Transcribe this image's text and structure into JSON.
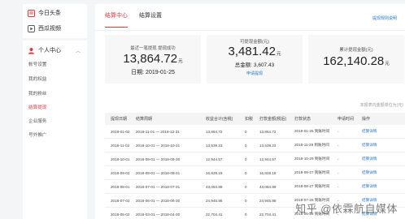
{
  "sidebar": {
    "top_items": [
      {
        "label": "今日头条",
        "icon": "toutiao-icon"
      },
      {
        "label": "西瓜视频",
        "icon": "xigua-icon"
      }
    ],
    "section_label": "个人中心",
    "sub_items": [
      "帐号设置",
      "我的权益",
      "我的粉丝",
      "结算提现",
      "企业服务",
      "号外推广"
    ],
    "active_sub": "结算提现"
  },
  "tabs": [
    "结算中心",
    "结算设置"
  ],
  "help_link": "提现规则说明",
  "cards": {
    "last": {
      "label": "最近一笔提现 提现成功",
      "amount": "13,864.72",
      "unit": "元",
      "date_label": "日期:",
      "date": "2019-01-25"
    },
    "available": {
      "label": "可提现金额(元)",
      "amount": "3,481.42",
      "unit": "元",
      "total_label": "总金额:",
      "total": "3,607.43",
      "link": "申请提现"
    },
    "cumulative": {
      "label": "累计提现金额(元)",
      "amount": "162,140.28",
      "unit": "元"
    }
  },
  "unit_note": "本报表内金额单位为(元)",
  "table": {
    "headers": [
      "提现日期",
      "结算周期",
      "收益合计(含税)",
      "扣税",
      "打款金额(税后)",
      "打款状态",
      "申请时间",
      "操作"
    ],
    "rows": [
      [
        "2019-01-02",
        "2018-11-01 — 2018-12-31",
        "13,864.72",
        "0",
        "13,864.72",
        "提现成功",
        "2019-01-25 到账时间",
        "-",
        "结算详情"
      ],
      [
        "2018-11-02",
        "2018-10-01 — 2018-10-31",
        "13,539.23",
        "0",
        "13,539.23",
        "提现成功",
        "2018-11-29 到账时间",
        "-",
        "结算详情"
      ],
      [
        "2018-10-01",
        "2018-09-01 — 2018-09-30",
        "12,944.57",
        "0",
        "12,944.57",
        "提现成功",
        "2018-10-29 到账时间",
        "-",
        "结算详情"
      ],
      [
        "2018-09-02",
        "2018-08-01 — 2018-08-31",
        "16,828.19",
        "0",
        "16,828.19",
        "提现成功",
        "2018-09-27 到账时间",
        "-",
        "结算详情"
      ],
      [
        "2018-08-01",
        "2018-07-01 — 2018-07-31",
        "43,084.89",
        "0",
        "43,084.89",
        "提现成功",
        "2018-08-27 到账时间",
        "-",
        "结算详情"
      ],
      [
        "2018-07-02",
        "2018-06-01 — 2018-06-30",
        "24,945.86",
        "0",
        "24,945.86",
        "提现成功",
        "2018-07-26 到账时间",
        "-",
        "结算详情"
      ],
      [
        "2018-05-02",
        "2018-03-01 — 2018-04-30",
        "22,704.41",
        "0",
        "22,704.41",
        "提现成功",
        "2018-05-28 到账时间",
        "-",
        "结算详情"
      ]
    ]
  },
  "watermark": "知乎 @依霖航自媒体",
  "colors": {
    "accent": "#e4393c",
    "link": "#2878c8"
  }
}
